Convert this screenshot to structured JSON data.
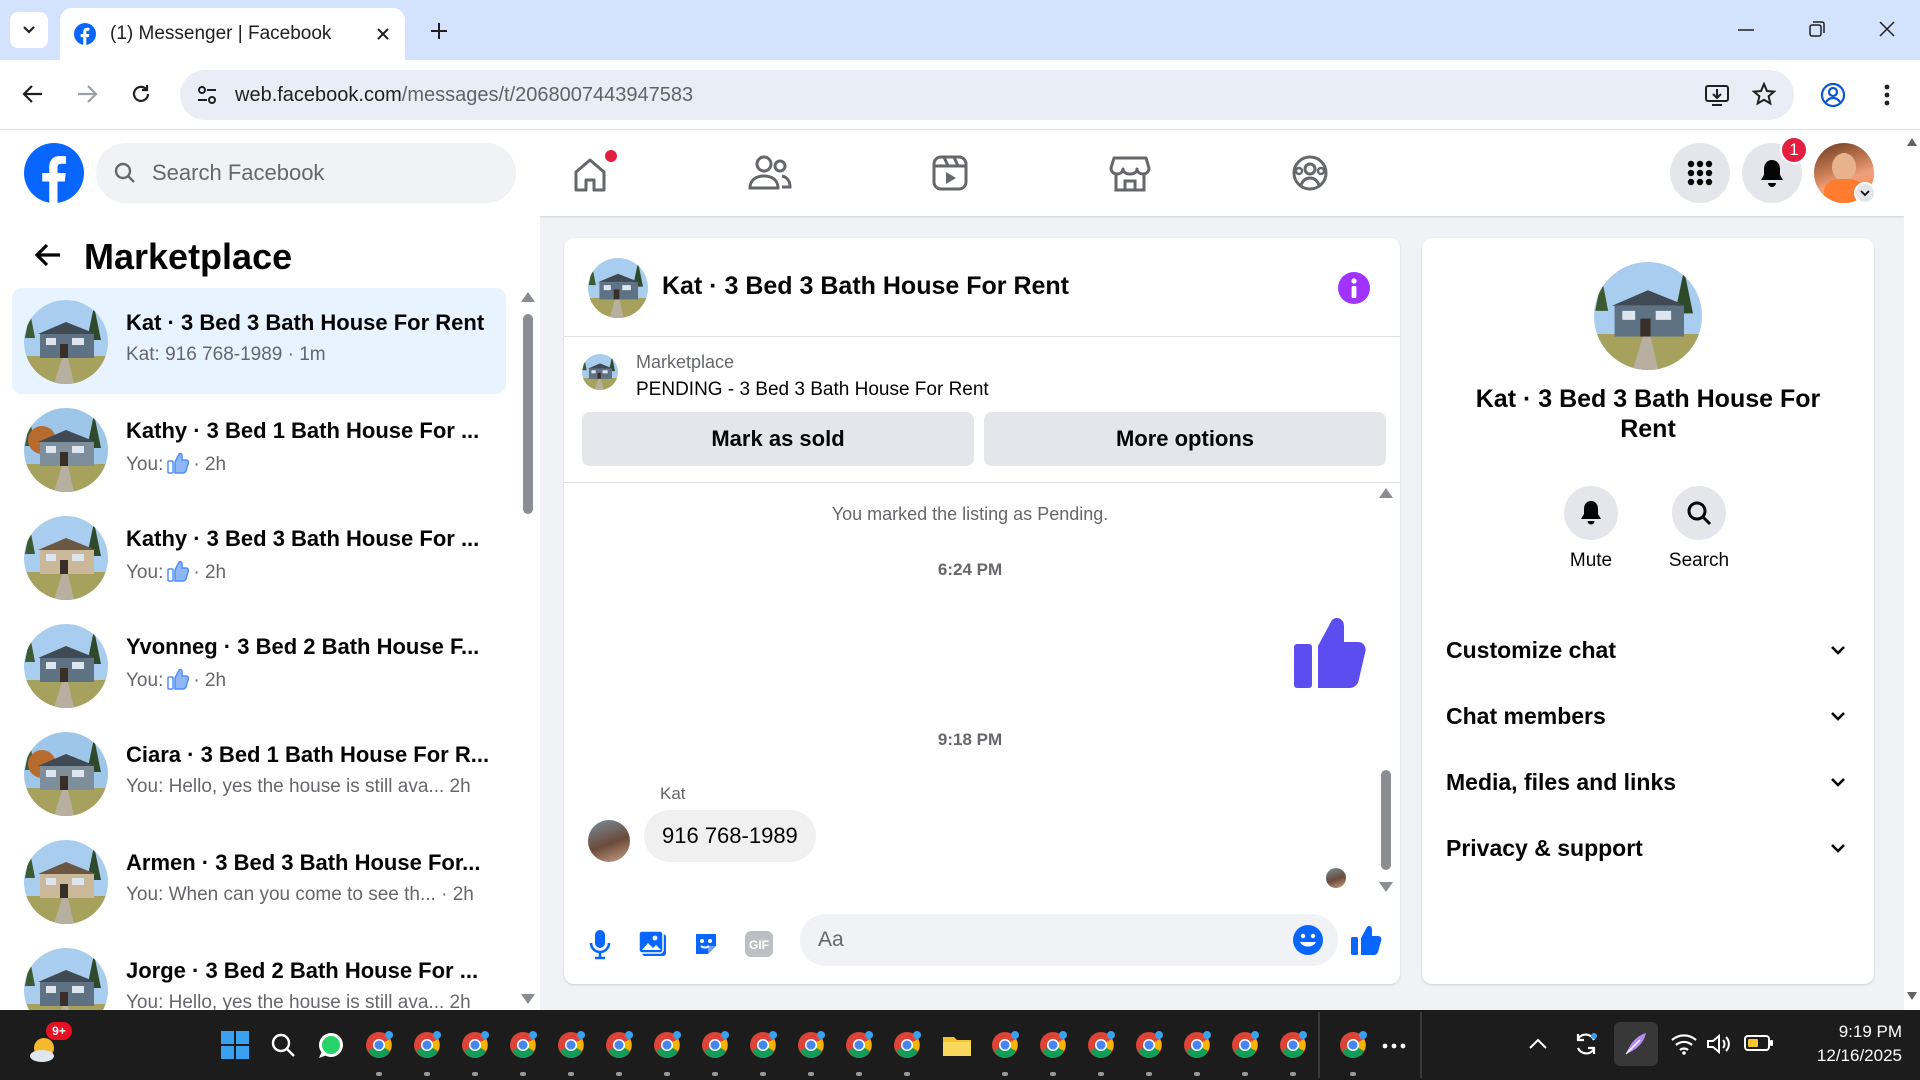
{
  "browser": {
    "tab_title": "(1) Messenger | Facebook",
    "url_host": "web.facebook.com",
    "url_path": "/messages/t/2068007443947583"
  },
  "fb_header": {
    "search_placeholder": "Search Facebook",
    "notification_count": "1"
  },
  "sidebar": {
    "title": "Marketplace",
    "conversations": [
      {
        "name": "Kat · 3 Bed 3 Bath House For Rent",
        "preview": "Kat: 916 768-1989 · 1m",
        "active": true
      },
      {
        "name": "Kathy · 3 Bed 1 Bath House For ...",
        "preview_prefix": "You:",
        "time": "· 2h"
      },
      {
        "name": "Kathy · 3 Bed 3 Bath House For ...",
        "preview_prefix": "You:",
        "time": "· 2h"
      },
      {
        "name": "Yvonneg · 3 Bed 2 Bath House F...",
        "preview_prefix": "You:",
        "time": "· 2h"
      },
      {
        "name": "Ciara · 3 Bed 1 Bath House For R...",
        "preview": "You: Hello, yes the house is still ava...",
        "time": "2h"
      },
      {
        "name": "Armen · 3 Bed 3 Bath House For...",
        "preview": "You: When can you come to see th...",
        "time": "· 2h"
      },
      {
        "name": "Jorge · 3 Bed 2 Bath House For ...",
        "preview": "You: Hello, yes the house is still ava...",
        "time": "2h"
      }
    ]
  },
  "chat": {
    "title": "Kat · 3 Bed 3 Bath House For Rent",
    "listing_label": "Marketplace",
    "listing_status": "PENDING - 3 Bed 3 Bath House For Rent",
    "mark_sold_label": "Mark as sold",
    "more_options_label": "More options",
    "system_message": "You marked the listing as Pending.",
    "time1": "6:24 PM",
    "time2": "9:18 PM",
    "sender_name": "Kat",
    "incoming_message": "916 768-1989",
    "composer_placeholder": "Aa"
  },
  "details": {
    "name": "Kat · 3 Bed 3 Bath House For Rent",
    "mute_label": "Mute",
    "search_label": "Search",
    "sections": [
      "Customize chat",
      "Chat members",
      "Media, files and links",
      "Privacy & support"
    ]
  },
  "taskbar": {
    "weather_badge": "9+",
    "time": "9:19 PM",
    "date": "12/16/2025"
  },
  "colors": {
    "fb_blue": "#0866ff",
    "active_row": "#e7f3ff",
    "like_purple": "#5b4df0",
    "info_purple": "#a033ff",
    "badge_red": "#e41e3f"
  }
}
